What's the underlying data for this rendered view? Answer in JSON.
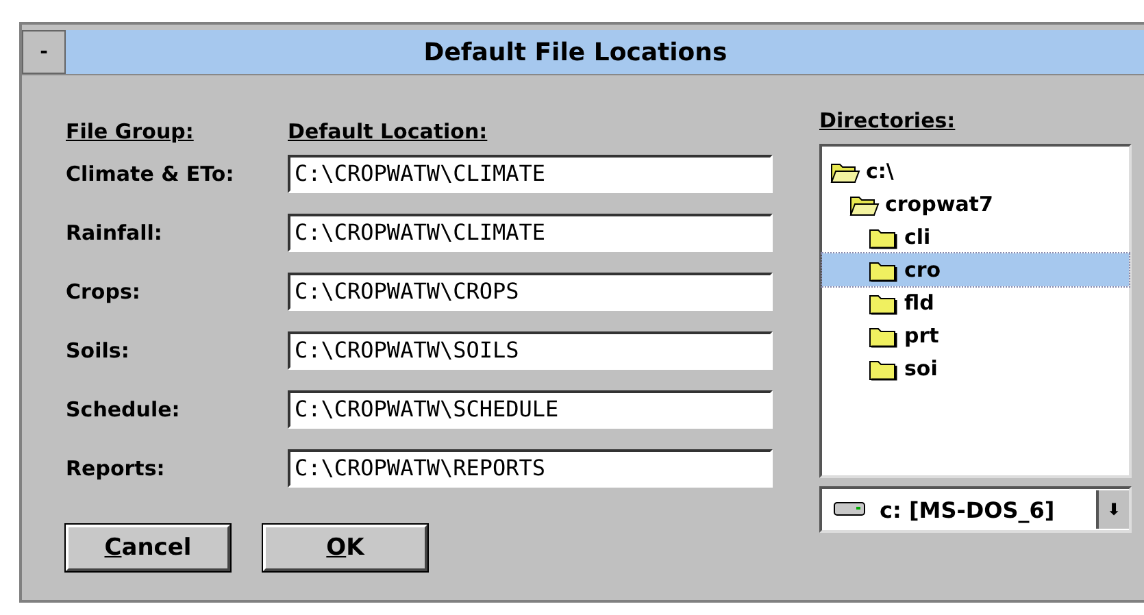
{
  "window": {
    "title": "Default File Locations",
    "control_menu": "-"
  },
  "headers": {
    "file_group": "File Group:",
    "default_location": "Default Location:",
    "directories": "Directories:"
  },
  "locations": [
    {
      "label": "Climate & ETo:",
      "value": "C:\\CROPWATW\\CLIMATE"
    },
    {
      "label": "Rainfall:",
      "value": "C:\\CROPWATW\\CLIMATE"
    },
    {
      "label": "Crops:",
      "value": "C:\\CROPWATW\\CROPS"
    },
    {
      "label": "Soils:",
      "value": "C:\\CROPWATW\\SOILS"
    },
    {
      "label": "Schedule:",
      "value": "C:\\CROPWATW\\SCHEDULE"
    },
    {
      "label": "Reports:",
      "value": "C:\\CROPWATW\\REPORTS"
    }
  ],
  "directories": [
    {
      "name": "c:\\",
      "expanded": true,
      "selected": false,
      "children": [
        {
          "name": "cropwat7",
          "expanded": true,
          "selected": false,
          "children": [
            {
              "name": "cli",
              "expanded": false,
              "selected": false
            },
            {
              "name": "cro",
              "expanded": false,
              "selected": true
            },
            {
              "name": "fld",
              "expanded": false,
              "selected": false
            },
            {
              "name": "prt",
              "expanded": false,
              "selected": false
            },
            {
              "name": "soi",
              "expanded": false,
              "selected": false
            }
          ]
        }
      ]
    }
  ],
  "drive": {
    "value": "c: [MS-DOS_6]",
    "arrow": "⬇"
  },
  "buttons": [
    {
      "mnemonic": "C",
      "rest": "ancel"
    },
    {
      "mnemonic": "O",
      "rest": "K"
    }
  ]
}
